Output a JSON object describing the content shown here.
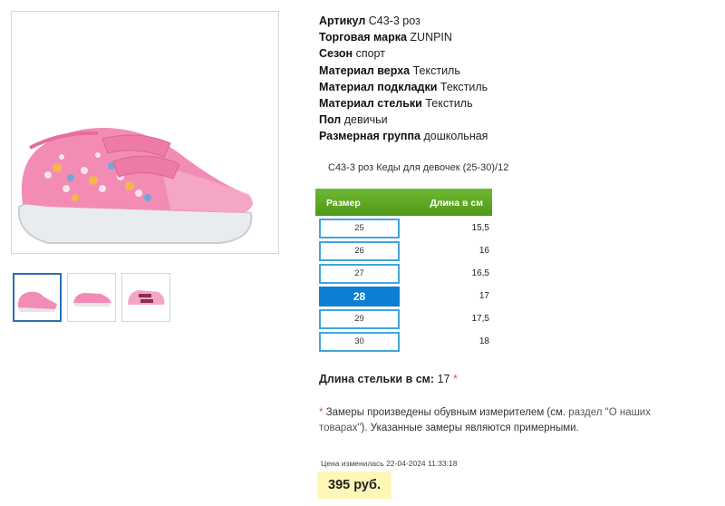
{
  "specs": [
    {
      "label": "Артикул",
      "value": "С43-3 роз"
    },
    {
      "label": "Торговая марка",
      "value": "ZUNPIN"
    },
    {
      "label": "Сезон",
      "value": "спорт"
    },
    {
      "label": "Материал верха",
      "value": "Текстиль"
    },
    {
      "label": "Материал подкладки",
      "value": "Текстиль"
    },
    {
      "label": "Материал стельки",
      "value": "Текстиль"
    },
    {
      "label": "Пол",
      "value": "девичьи"
    },
    {
      "label": "Размерная группа",
      "value": "дошкольная"
    }
  ],
  "product_title": "С43-3 роз Кеды для девочек (25-30)/12",
  "size_table": {
    "header_size": "Размер",
    "header_length": "Длина в см",
    "rows": [
      {
        "size": "25",
        "length": "15,5"
      },
      {
        "size": "26",
        "length": "16"
      },
      {
        "size": "27",
        "length": "16,5"
      },
      {
        "size": "28",
        "length": "17"
      },
      {
        "size": "29",
        "length": "17,5"
      },
      {
        "size": "30",
        "length": "18"
      }
    ],
    "selected": "28"
  },
  "insole": {
    "label": "Длина стельки в см:",
    "value": "17",
    "mark": "*"
  },
  "note": {
    "star": "*",
    "text_before": " Замеры произведены обувным измерителем (см.",
    "link": " раздел \"О наших товарах\"",
    "text_after": "). Указанные замеры являются примерными."
  },
  "price_changed": "Цена изменилась 22-04-2024 11:33:18",
  "price": "395 руб.",
  "colors": {
    "accent_green": "#5aa820",
    "size_border": "#42a4e0",
    "size_selected": "#0d7fd2",
    "price_bg": "#fff7b8"
  },
  "images": {
    "main": "pink-sneaker-photo",
    "thumbs": [
      "pink-sneaker-side",
      "pink-sneaker-front",
      "pink-sneaker-top"
    ]
  }
}
